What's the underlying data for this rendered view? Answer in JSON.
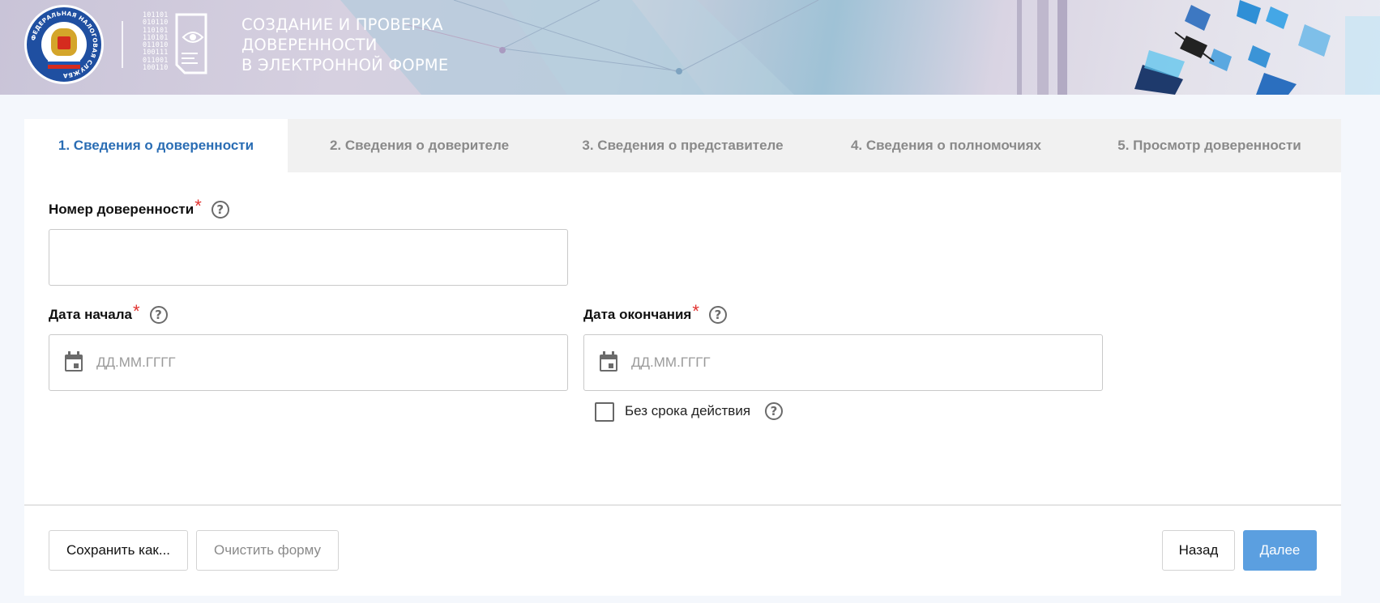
{
  "header": {
    "emblem_text": "ФЕДЕРАЛЬНАЯ НАЛОГОВАЯ СЛУЖБА",
    "binary_lines": [
      "101101",
      "010110",
      "110101",
      "110101",
      "011010",
      "100111",
      "011001",
      "100110"
    ],
    "title_lines": [
      "СОЗДАНИЕ И ПРОВЕРКА",
      "ДОВЕРЕННОСТИ",
      "В ЭЛЕКТРОННОЙ ФОРМЕ"
    ]
  },
  "tabs": [
    {
      "label": "1. Сведения о доверенности",
      "active": true
    },
    {
      "label": "2. Сведения о доверителе",
      "active": false
    },
    {
      "label": "3. Сведения о представителе",
      "active": false
    },
    {
      "label": "4. Сведения о полномочиях",
      "active": false
    },
    {
      "label": "5. Просмотр доверенности",
      "active": false
    }
  ],
  "form": {
    "number": {
      "label": "Номер доверенности",
      "required_mark": "*",
      "value": "",
      "help": "?"
    },
    "start_date": {
      "label": "Дата начала",
      "required_mark": "*",
      "placeholder": "ДД.ММ.ГГГГ",
      "help": "?",
      "icon": "calendar-icon"
    },
    "end_date": {
      "label": "Дата окончания",
      "required_mark": "*",
      "placeholder": "ДД.ММ.ГГГГ",
      "help": "?",
      "icon": "calendar-icon"
    },
    "no_expiry": {
      "label": "Без срока действия",
      "checked": false,
      "help": "?"
    }
  },
  "footer": {
    "save_as": "Сохранить как...",
    "clear": "Очистить форму",
    "back": "Назад",
    "next": "Далее"
  },
  "colors": {
    "accent": "#2a6db4",
    "primary_button": "#5b9fe0",
    "required": "#e1322f",
    "emblem": "#1f4fa1"
  }
}
